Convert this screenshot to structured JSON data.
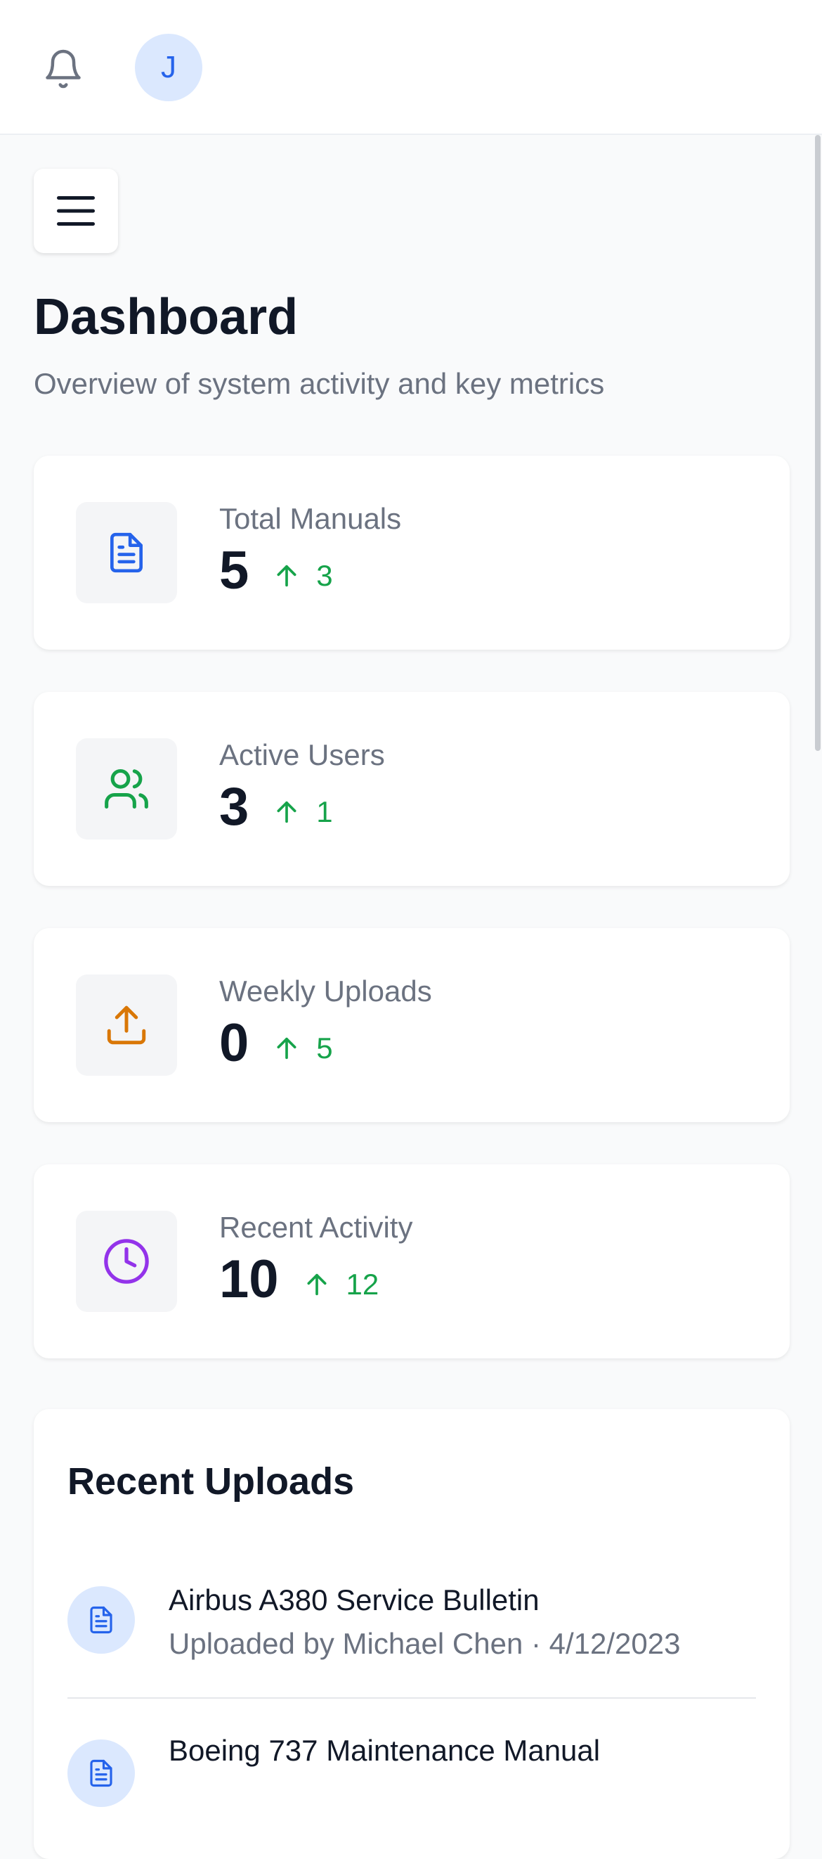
{
  "header": {
    "avatar_initial": "J"
  },
  "page": {
    "title": "Dashboard",
    "subtitle": "Overview of system activity and key metrics"
  },
  "stats": [
    {
      "label": "Total Manuals",
      "value": "5",
      "trend": "3",
      "icon": "document-icon",
      "color": "#2563eb"
    },
    {
      "label": "Active Users",
      "value": "3",
      "trend": "1",
      "icon": "users-icon",
      "color": "#16a34a"
    },
    {
      "label": "Weekly Uploads",
      "value": "0",
      "trend": "5",
      "icon": "upload-icon",
      "color": "#d97706"
    },
    {
      "label": "Recent Activity",
      "value": "10",
      "trend": "12",
      "icon": "clock-icon",
      "color": "#9333ea"
    }
  ],
  "recent_uploads": {
    "title": "Recent Uploads",
    "items": [
      {
        "name": "Airbus A380 Service Bulletin",
        "meta": "Uploaded by Michael Chen · 4/12/2023"
      },
      {
        "name": "Boeing 737 Maintenance Manual",
        "meta": ""
      }
    ]
  },
  "colors": {
    "trend_up": "#16a34a",
    "accent": "#2563eb"
  }
}
